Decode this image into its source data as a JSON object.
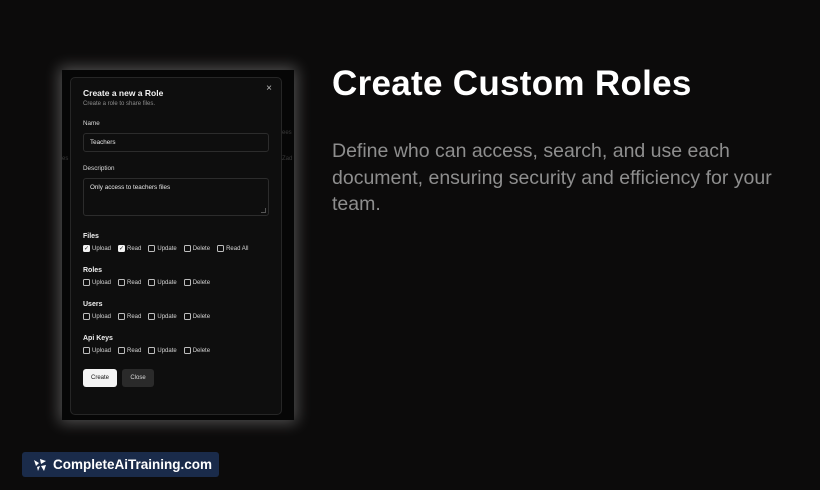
{
  "headline": "Create Custom Roles",
  "description": "Define who can access, search, and use each document, ensuring security and efficiency for your team.",
  "brand": {
    "name": "CompleteAiTraining.com",
    "icon": "brand-logo-icon"
  },
  "background_fragments": [
    "ees",
    "es",
    "Zad"
  ],
  "dialog": {
    "title": "Create a new a Role",
    "subtitle": "Create a role to share files.",
    "close_label": "×",
    "name_label": "Name",
    "name_value": "Teachers",
    "description_label": "Description",
    "description_value": "Only access to teachers files",
    "groups": [
      {
        "title": "Files",
        "perms": [
          {
            "label": "Upload",
            "checked": true
          },
          {
            "label": "Read",
            "checked": true
          },
          {
            "label": "Update",
            "checked": false
          },
          {
            "label": "Delete",
            "checked": false
          },
          {
            "label": "Read All",
            "checked": false
          }
        ]
      },
      {
        "title": "Roles",
        "perms": [
          {
            "label": "Upload",
            "checked": false
          },
          {
            "label": "Read",
            "checked": false
          },
          {
            "label": "Update",
            "checked": false
          },
          {
            "label": "Delete",
            "checked": false
          }
        ]
      },
      {
        "title": "Users",
        "perms": [
          {
            "label": "Upload",
            "checked": false
          },
          {
            "label": "Read",
            "checked": false
          },
          {
            "label": "Update",
            "checked": false
          },
          {
            "label": "Delete",
            "checked": false
          }
        ]
      },
      {
        "title": "Api Keys",
        "perms": [
          {
            "label": "Upload",
            "checked": false
          },
          {
            "label": "Read",
            "checked": false
          },
          {
            "label": "Update",
            "checked": false
          },
          {
            "label": "Delete",
            "checked": false
          }
        ]
      }
    ],
    "create_label": "Create",
    "close_button_label": "Close"
  }
}
